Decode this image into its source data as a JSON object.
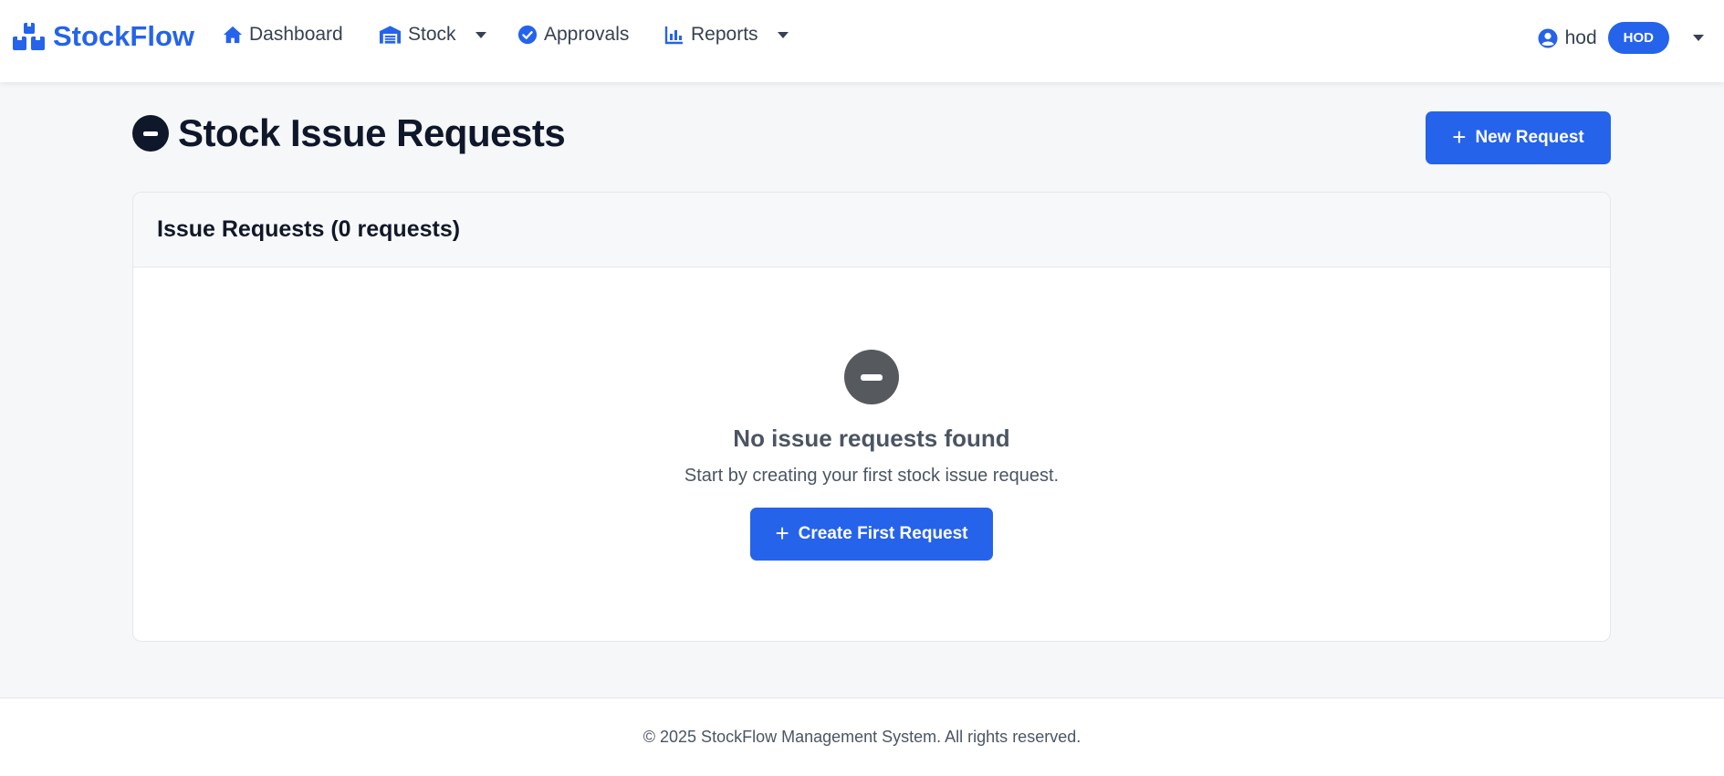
{
  "app": {
    "brand": "StockFlow",
    "brand_color": "#2563eb"
  },
  "nav": {
    "items": [
      {
        "label": "Dashboard",
        "icon": "home-icon",
        "has_dropdown": false
      },
      {
        "label": "Stock",
        "icon": "warehouse-icon",
        "has_dropdown": true
      },
      {
        "label": "Approvals",
        "icon": "check-circle-icon",
        "has_dropdown": false
      },
      {
        "label": "Reports",
        "icon": "bar-chart-icon",
        "has_dropdown": true
      }
    ],
    "user": {
      "icon": "user-circle-icon",
      "name": "hod",
      "role": "HOD"
    }
  },
  "page": {
    "title": "Stock Issue Requests",
    "title_icon": "minus-circle-icon",
    "new_request_label": "New Request"
  },
  "card": {
    "header": "Issue Requests (0 requests)",
    "empty": {
      "icon": "minus-circle-icon",
      "title": "No issue requests found",
      "subtitle": "Start by creating your first stock issue request.",
      "button_label": "Create First Request"
    }
  },
  "footer": {
    "text": "© 2025 StockFlow Management System. All rights reserved."
  }
}
